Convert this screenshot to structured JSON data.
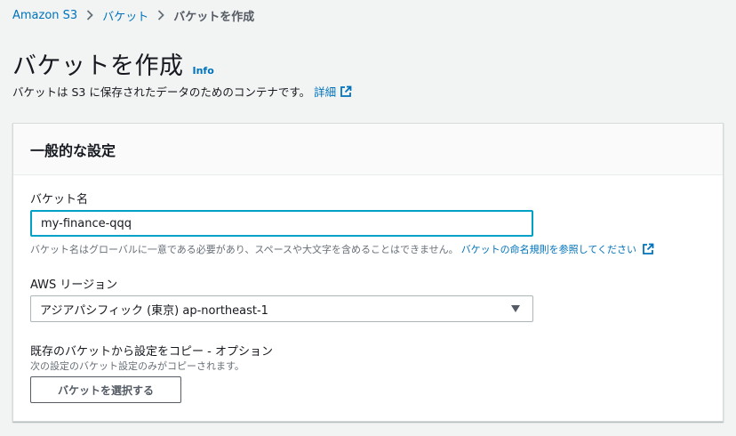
{
  "breadcrumb": {
    "items": [
      "Amazon S3",
      "バケット"
    ],
    "current": "バケットを作成"
  },
  "header": {
    "title": "バケットを作成",
    "info_label": "Info",
    "description": "バケットは S3 に保存されたデータのためのコンテナです。",
    "details_link": "詳細"
  },
  "panel": {
    "title": "一般的な設定",
    "bucket_name": {
      "label": "バケット名",
      "value": "my-finance-qqq",
      "hint": "バケット名はグローバルに一意である必要があり、スペースや大文字を含めることはできません。",
      "hint_link": "バケットの命名規則を参照してください"
    },
    "region": {
      "label": "AWS リージョン",
      "selected": "アジアパシフィック (東京) ap-northeast-1"
    },
    "copy_settings": {
      "label": "既存のバケットから設定をコピー - オプション",
      "hint": "次の設定のバケット設定のみがコピーされます。",
      "button_label": "バケットを選択する"
    }
  },
  "colors": {
    "link": "#0073bb",
    "focus_border": "#00a1c9",
    "background": "#f2f3f3"
  },
  "icons": [
    "chevron-right-icon",
    "external-link-icon",
    "caret-down-icon"
  ]
}
